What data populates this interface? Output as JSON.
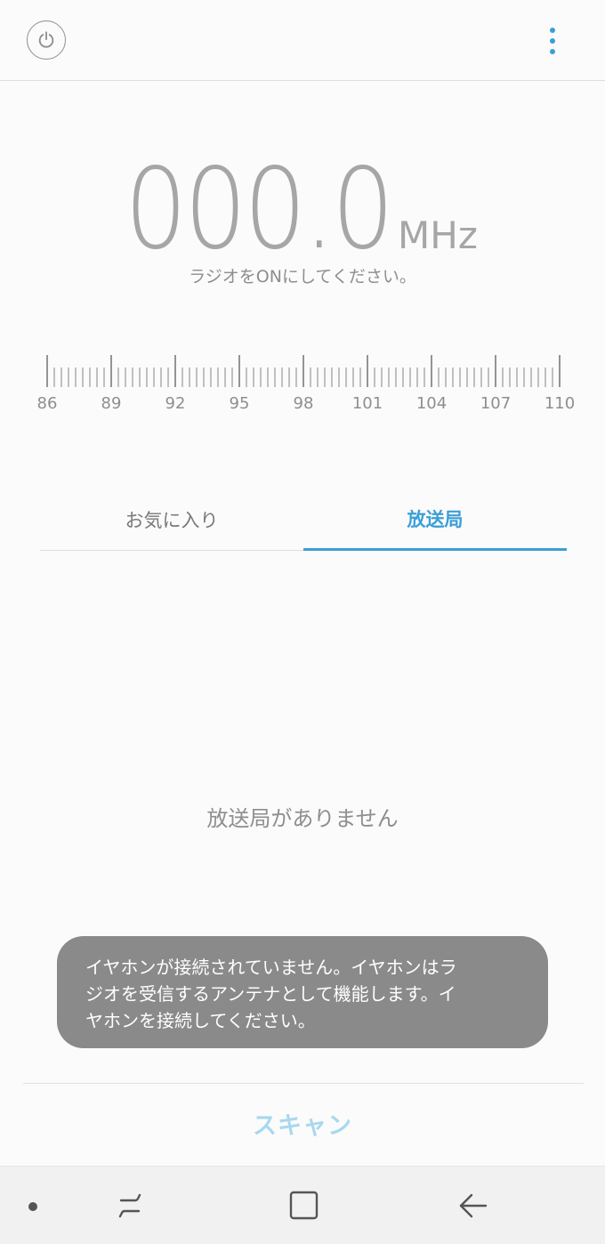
{
  "header": {
    "power_icon": "power-icon",
    "menu_icon": "more-vert-icon",
    "accent_color": "#3b9fd6"
  },
  "frequency": {
    "value": "000.0",
    "unit": "MHz",
    "hint": "ラジオをONにしてください。"
  },
  "scale": {
    "min": 86,
    "max": 110,
    "labels": [
      "86",
      "89",
      "92",
      "95",
      "98",
      "101",
      "104",
      "107",
      "110"
    ]
  },
  "tabs": {
    "favorites_label": "お気に入り",
    "stations_label": "放送局",
    "active": "stations"
  },
  "stations": {
    "empty_message": "放送局がありません"
  },
  "toast": {
    "lines": [
      "イヤホンが接続されていません。イヤホンはラ",
      "ジオを受信するアンテナとして機能します。イ",
      "ヤホンを接続してください。"
    ]
  },
  "footer": {
    "scan_label": "スキャン"
  },
  "navbar": {
    "dot_icon": "nav-dot-icon",
    "recent_icon": "recent-apps-icon",
    "home_icon": "home-icon",
    "back_icon": "back-icon"
  }
}
